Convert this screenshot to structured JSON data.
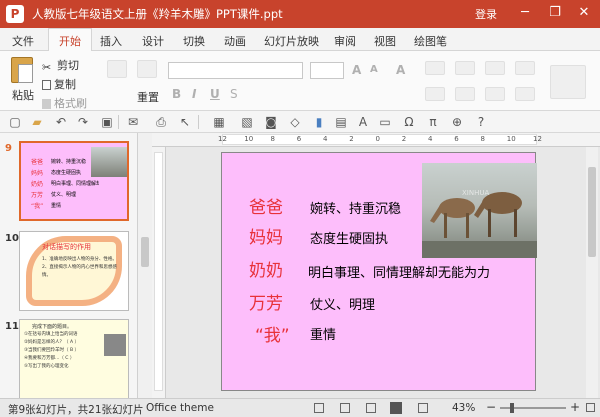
{
  "titlebar": {
    "app_badge": "P",
    "title": "人教版七年级语文上册《羚羊木雕》PPT课件.ppt",
    "login": "登录",
    "min": "─",
    "restore": "❐",
    "close": "✕"
  },
  "tabs": [
    "文件",
    "开始",
    "插入",
    "设计",
    "切换",
    "动画",
    "幻灯片放映",
    "审阅",
    "视图",
    "绘图笔"
  ],
  "ribbon": {
    "paste": "粘贴",
    "cut": "剪切",
    "copy": "复制",
    "format_painter": "格式刷",
    "reset": "重置"
  },
  "slides": [
    {
      "number": "9",
      "labels": [
        "爸爸",
        "妈妈",
        "奶奶",
        "万芳",
        "“我”"
      ],
      "texts": [
        "婉转、持重沉稳",
        "态度生硬固执",
        "明白事理、同情理解却无能为力",
        "仗义、明理",
        "重情"
      ]
    },
    {
      "number": "10",
      "title": "对话描写的作用",
      "lines": [
        "1、准确地反映出人物的身分、性格。",
        "2、直接揭示人物的内心世界和思想感情。"
      ]
    },
    {
      "number": "11",
      "heading": "完成下面的题目。",
      "lines": [
        "①在括号内填上恰当的词语",
        "②妈妈是怎样的人？（  A  ）",
        "③当我们要回羚羊时（  B  ）",
        "④我要和万芳都...（  C  ）",
        "⑤写出了我的心理变化"
      ]
    }
  ],
  "main_slide": {
    "labels": [
      "爸爸",
      "妈妈",
      "奶奶",
      "万芳",
      "“我”"
    ],
    "texts": [
      "婉转、持重沉稳",
      "态度生硬固执",
      "明白事理、同情理解却无能为力",
      "仗义、明理",
      "重情"
    ],
    "photo_watermark": "XINHUA"
  },
  "ruler_ticks": [
    "12",
    "10",
    "8",
    "6",
    "4",
    "2",
    "0",
    "2",
    "4",
    "6",
    "8",
    "10",
    "12"
  ],
  "status": {
    "slide_info": "第9张幻灯片，共21张幻灯片",
    "theme": "Office theme",
    "zoom": "43%"
  },
  "colors": {
    "titlebar": "#c8432c",
    "slide_bg": "#fdbefb",
    "label_red": "#e8323a",
    "accent_orange": "#e0682a"
  }
}
